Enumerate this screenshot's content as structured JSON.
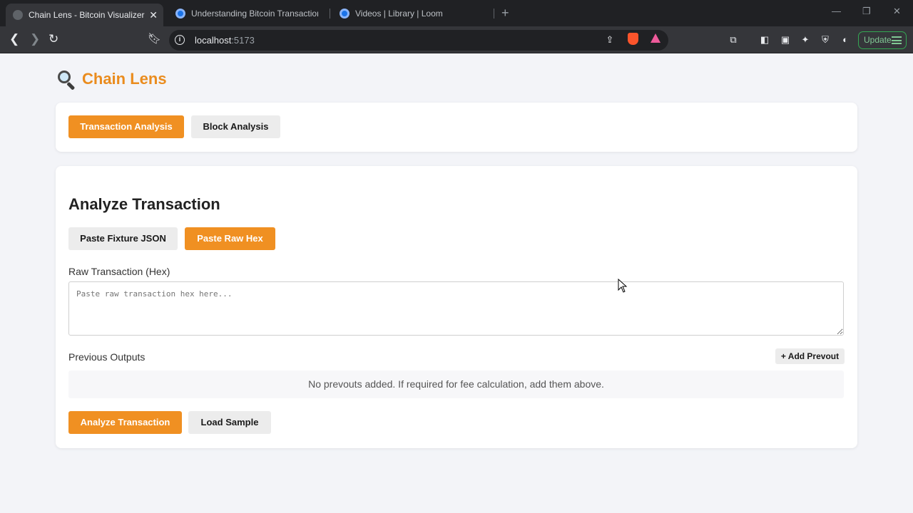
{
  "browser": {
    "tabs": [
      {
        "title": "Chain Lens - Bitcoin Visualizer",
        "active": true
      },
      {
        "title": "Understanding Bitcoin Transactions a",
        "active": false
      },
      {
        "title": "Videos | Library | Loom",
        "active": false
      }
    ],
    "url_host": "localhost",
    "url_port": ":5173",
    "update_label": "Update"
  },
  "app": {
    "title": "Chain Lens",
    "logo_icon": "magnifying-glass-icon",
    "accent_color": "#f09022"
  },
  "mode_tabs": {
    "transaction": "Transaction Analysis",
    "block": "Block Analysis",
    "active": "transaction"
  },
  "analyze": {
    "heading": "Analyze Transaction",
    "input_modes": {
      "fixture": "Paste Fixture JSON",
      "raw_hex": "Paste Raw Hex",
      "active": "raw_hex"
    },
    "raw_hex_label": "Raw Transaction (Hex)",
    "raw_hex_placeholder": "Paste raw transaction hex here...",
    "raw_hex_value": "",
    "prevouts_label": "Previous Outputs",
    "add_prevout_label": "+ Add Prevout",
    "prevouts_empty": "No prevouts added. If required for fee calculation, add them above.",
    "analyze_button": "Analyze Transaction",
    "sample_button": "Load Sample"
  }
}
